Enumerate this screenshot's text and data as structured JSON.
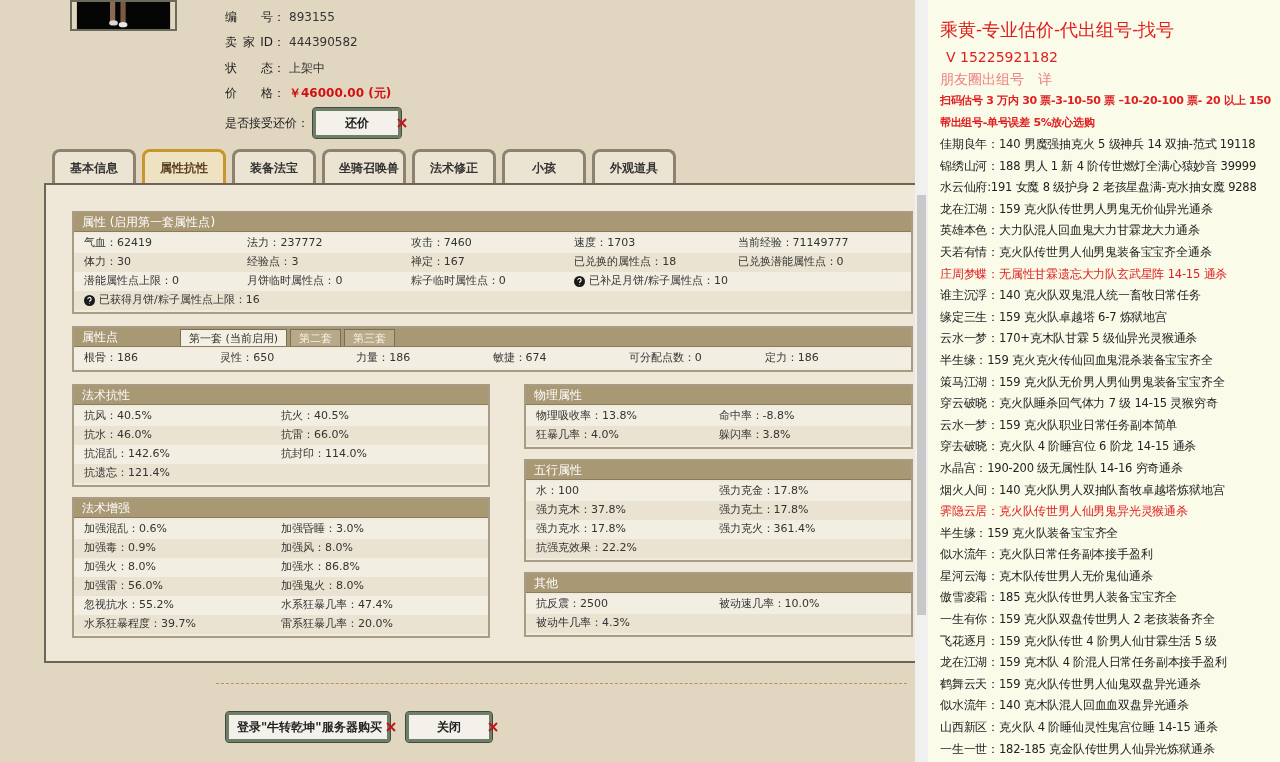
{
  "item_info": {
    "fields": [
      {
        "label": [
          "编",
          "号："
        ],
        "value": "893155",
        "kind": "plain"
      },
      {
        "label": [
          "卖",
          "家",
          "ID："
        ],
        "value": "444390582",
        "kind": "plain"
      },
      {
        "label": [
          "状",
          "态："
        ],
        "value": "上架中",
        "kind": "plain"
      },
      {
        "label": [
          "价",
          "格："
        ],
        "value": "￥46000.00 (元)",
        "kind": "price"
      }
    ],
    "counter_offer": {
      "label": "是否接受还价：",
      "button": "还价"
    }
  },
  "tabs": [
    {
      "label": "基本信息",
      "selected": false
    },
    {
      "label": "属性抗性",
      "selected": true
    },
    {
      "label": "装备法宝",
      "selected": false
    },
    {
      "label": "坐骑召唤兽",
      "selected": false
    },
    {
      "label": "法术修正",
      "selected": false
    },
    {
      "label": "小孩",
      "selected": false
    },
    {
      "label": "外观道具",
      "selected": false
    }
  ],
  "attributes": {
    "title": "属性 (启用第一套属性点)",
    "rows": [
      [
        {
          "text": "气血：62419",
          "help": false
        },
        {
          "text": "法力：237772",
          "help": false
        },
        {
          "text": "攻击：7460",
          "help": false
        },
        {
          "text": "速度：1703",
          "help": false
        },
        {
          "text": "当前经验：71149777",
          "help": false
        }
      ],
      [
        {
          "text": "体力：30",
          "help": false
        },
        {
          "text": "经验点：3",
          "help": false
        },
        {
          "text": "禅定：167",
          "help": false
        },
        {
          "text": "已兑换的属性点：18",
          "help": false
        },
        {
          "text": "已兑换潜能属性点：0",
          "help": false
        }
      ],
      [
        {
          "text": "潜能属性点上限：0",
          "help": false
        },
        {
          "text": "月饼临时属性点：0",
          "help": false
        },
        {
          "text": "粽子临时属性点：0",
          "help": false
        },
        {
          "text": "已补足月饼/粽子属性点：10",
          "help": true
        }
      ],
      [
        {
          "text": "已获得月饼/粽子属性点上限：16",
          "help": true
        }
      ]
    ]
  },
  "attribute_points": {
    "title": "属性点",
    "tabs": [
      {
        "label": "第一套 (当前启用)",
        "selected": true
      },
      {
        "label": "第二套",
        "selected": false
      },
      {
        "label": "第三套",
        "selected": false
      }
    ],
    "values": [
      "根骨：186",
      "灵性：650",
      "力量：186",
      "敏捷：674",
      "可分配点数：0",
      "定力：186"
    ]
  },
  "left_panels": [
    {
      "title": "法术抗性",
      "cells": [
        "抗风：40.5%",
        "抗火：40.5%",
        "抗水：46.0%",
        "抗雷：66.0%",
        "抗混乱：142.6%",
        "抗封印：114.0%",
        "抗遗忘：121.4%"
      ]
    },
    {
      "title": "法术增强",
      "cells": [
        "加强混乱：0.6%",
        "加强昏睡：3.0%",
        "加强毒：0.9%",
        "加强风：8.0%",
        "加强火：8.0%",
        "加强水：86.8%",
        "加强雷：56.0%",
        "加强鬼火：8.0%",
        "忽视抗水：55.2%",
        "水系狂暴几率：47.4%",
        "水系狂暴程度：39.7%",
        "雷系狂暴几率：20.0%"
      ]
    }
  ],
  "right_panels": [
    {
      "title": "物理属性",
      "cells": [
        "物理吸收率：13.8%",
        "命中率：-8.8%",
        "狂暴几率：4.0%",
        "躲闪率：3.8%"
      ]
    },
    {
      "title": "五行属性",
      "cells": [
        "水：100",
        "强力克金：17.8%",
        "强力克木：37.8%",
        "强力克土：17.8%",
        "强力克水：17.8%",
        "强力克火：361.4%",
        "抗强克效果：22.2%"
      ]
    },
    {
      "title": "其他",
      "cells": [
        "抗反震：2500",
        "被动速几率：10.0%",
        "被动牛几率：4.3%"
      ]
    }
  ],
  "buttons": [
    "登录\"牛转乾坤\"服务器购买",
    "关闭"
  ],
  "ad": {
    "lines": [
      {
        "kind": "title",
        "text": "乘黄-专业估价-代出组号-找号",
        "color": "#e02020"
      },
      {
        "kind": "contact",
        "text": "V 15225921182",
        "color": "#e02020"
      },
      {
        "kind": "note",
        "text": "朋友圈出组号　详",
        "color": "#f08080"
      },
      {
        "kind": "promo",
        "text": "扫码估号 3 万内 30 票-3-10-50 票 –10-20-100 票- 20 以上 150",
        "color": "#e02020"
      },
      {
        "kind": "promo",
        "text": "帮出组号-单号误差 5%放心选购",
        "color": "#e02020"
      },
      {
        "kind": "entry",
        "text": "佳期良年：140 男魔强抽克火 5 级神兵 14 双抽-范式 19118",
        "color": "#222222"
      },
      {
        "kind": "entry",
        "text": "锦绣山河：188 男人 1 新 4 阶传世燃灯全满心猿妙音 39999",
        "color": "#222222"
      },
      {
        "kind": "entry",
        "text": "水云仙府:191 女魔 8 级护身 2 老孩星盘满-克水抽女魔 9288",
        "color": "#222222"
      },
      {
        "kind": "entry",
        "text": "龙在江湖：159 克火队传世男人男鬼无价仙异光通杀",
        "color": "#222222"
      },
      {
        "kind": "entry",
        "text": "英雄本色：大力队混人回血鬼大力甘霖龙大力通杀",
        "color": "#222222"
      },
      {
        "kind": "entry",
        "text": "天若有情：克火队传世男人仙男鬼装备宝宝齐全通杀",
        "color": "#222222"
      },
      {
        "kind": "entry",
        "text": "庄周梦蝶：无属性甘霖遗忘大力队玄武星阵 14-15 通杀",
        "color": "#e02020"
      },
      {
        "kind": "entry",
        "text": "谁主沉浮：140 克火队双鬼混人统一畜牧日常任务",
        "color": "#222222"
      },
      {
        "kind": "entry",
        "text": "缘定三生：159 克火队卓越塔 6-7 炼狱地宫",
        "color": "#222222"
      },
      {
        "kind": "entry",
        "text": "云水一梦：170+克木队甘霖 5 级仙异光灵猴通杀",
        "color": "#222222"
      },
      {
        "kind": "entry",
        "text": "半生缘：159 克火克火传仙回血鬼混杀装备宝宝齐全",
        "color": "#222222"
      },
      {
        "kind": "entry",
        "text": "策马江湖：159 克火队无价男人男仙男鬼装备宝宝齐全",
        "color": "#222222"
      },
      {
        "kind": "entry",
        "text": "穿云破晓：克火队睡杀回气体力 7 级 14-15 灵猴穷奇",
        "color": "#222222"
      },
      {
        "kind": "entry",
        "text": "云水一梦：159 克火队职业日常任务副本简单",
        "color": "#222222"
      },
      {
        "kind": "entry",
        "text": "穿去破晓：克火队 4 阶睡宫位 6 阶龙 14-15 通杀",
        "color": "#222222"
      },
      {
        "kind": "entry",
        "text": "水晶宫：190-200 级无属性队 14-16 穷奇通杀",
        "color": "#222222"
      },
      {
        "kind": "entry",
        "text": "烟火人间：140 克火队男人双抽队畜牧卓越塔炼狱地宫",
        "color": "#222222"
      },
      {
        "kind": "entry",
        "text": "霁隐云居：克火队传世男人仙男鬼异光灵猴通杀",
        "color": "#e02020"
      },
      {
        "kind": "entry",
        "text": "半生缘：159 克火队装备宝宝齐全",
        "color": "#222222"
      },
      {
        "kind": "entry",
        "text": "似水流年：克火队日常任务副本接手盈利",
        "color": "#222222"
      },
      {
        "kind": "entry",
        "text": "星河云海：克木队传世男人无价鬼仙通杀",
        "color": "#222222"
      },
      {
        "kind": "entry",
        "text": "傲雪凌霜：185 克火队传世男人装备宝宝齐全",
        "color": "#222222"
      },
      {
        "kind": "entry",
        "text": "一生有你：159 克火队双盘传世男人 2 老孩装备齐全",
        "color": "#222222"
      },
      {
        "kind": "entry",
        "text": "飞花逐月：159 克火队传世 4 阶男人仙甘霖生活 5 级",
        "color": "#222222"
      },
      {
        "kind": "entry",
        "text": "龙在江湖：159 克木队 4 阶混人日常任务副本接手盈利",
        "color": "#222222"
      },
      {
        "kind": "entry",
        "text": "鹤舞云天：159 克火队传世男人仙鬼双盘异光通杀",
        "color": "#222222"
      },
      {
        "kind": "entry",
        "text": "似水流年：140 克木队混人回血血双盘异光通杀",
        "color": "#222222"
      },
      {
        "kind": "entry",
        "text": "山西新区：克火队 4 阶睡仙灵性鬼宫位睡 14-15 通杀",
        "color": "#222222"
      },
      {
        "kind": "entry",
        "text": "一生一世：182-185 克金队传世男人仙异光炼狱通杀",
        "color": "#222222"
      }
    ]
  }
}
